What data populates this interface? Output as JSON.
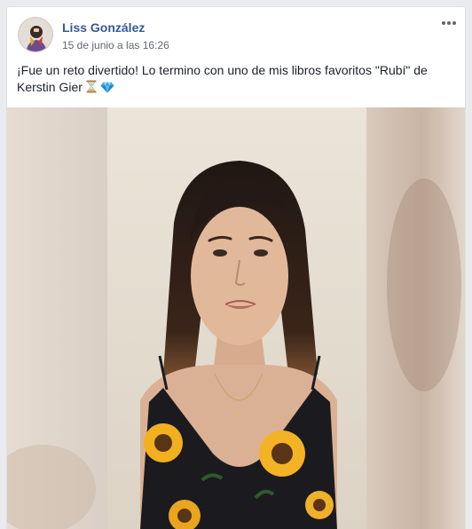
{
  "post": {
    "author": "Liss González",
    "timestamp": "15 de junio a las 16:26",
    "caption": "¡Fue un reto divertido! Lo termino con uno de mis libros favoritos \"Rubí\" de Kerstin Gier",
    "caption_emojis": [
      "hourglass-icon",
      "gem-icon"
    ],
    "more_options_icon": "more-horizontal-icon"
  },
  "colors": {
    "author_link": "#385898",
    "timestamp": "#616770",
    "text": "#1d2129",
    "page_background": "#e9ebee",
    "card_border": "#dddfe2"
  }
}
